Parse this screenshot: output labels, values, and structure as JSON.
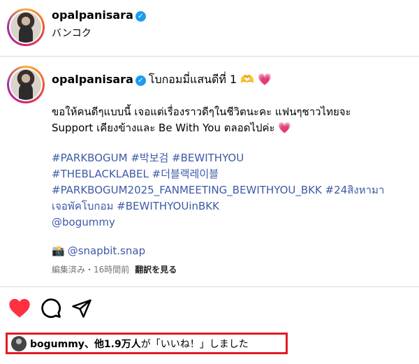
{
  "header": {
    "username": "opalpanisara",
    "location": "バンコク"
  },
  "post": {
    "username": "opalpanisara",
    "title": "โบกอมมี่แสนดีที่ 1",
    "title_emoji": "🫶",
    "heart_emoji": "💗",
    "body_line1": "ขอให้คนดีๆแบบนี้ เจอแต่เรื่องราวดีๆในชีวิตนะคะ แฟนๆชาวไทยจะ",
    "body_line2": "Support เคียงข้างและ Be With You ตลอดไปค่ะ",
    "hashtags": [
      "#PARKBOGUM #박보검 #BEWITHYOU",
      "#THEBLACKLABEL #더블랙레이블",
      "#PARKBOGUM2025_FANMEETING_BEWITHYOU_BKK #24สิงหามา",
      "เจอพัคโบกอม #BEWITHYOUinBKK",
      "@bogummy"
    ],
    "camera_emoji": "📸",
    "snap_handle": "@snapbit.snap",
    "meta": "編集済み・16時間前",
    "translate": "翻訳を見る"
  },
  "likes": {
    "user": "bogummy",
    "sep": "、",
    "others": "他1.9万人",
    "suffix": "が「いいね！」しました"
  },
  "icons": {
    "like": "heart-filled-icon",
    "comment": "comment-icon",
    "share": "paper-plane-icon"
  },
  "colors": {
    "like": "#ff3040",
    "link": "#3d5aa8",
    "verified": "#1d9bf0",
    "highlight_box": "#e31b23"
  }
}
